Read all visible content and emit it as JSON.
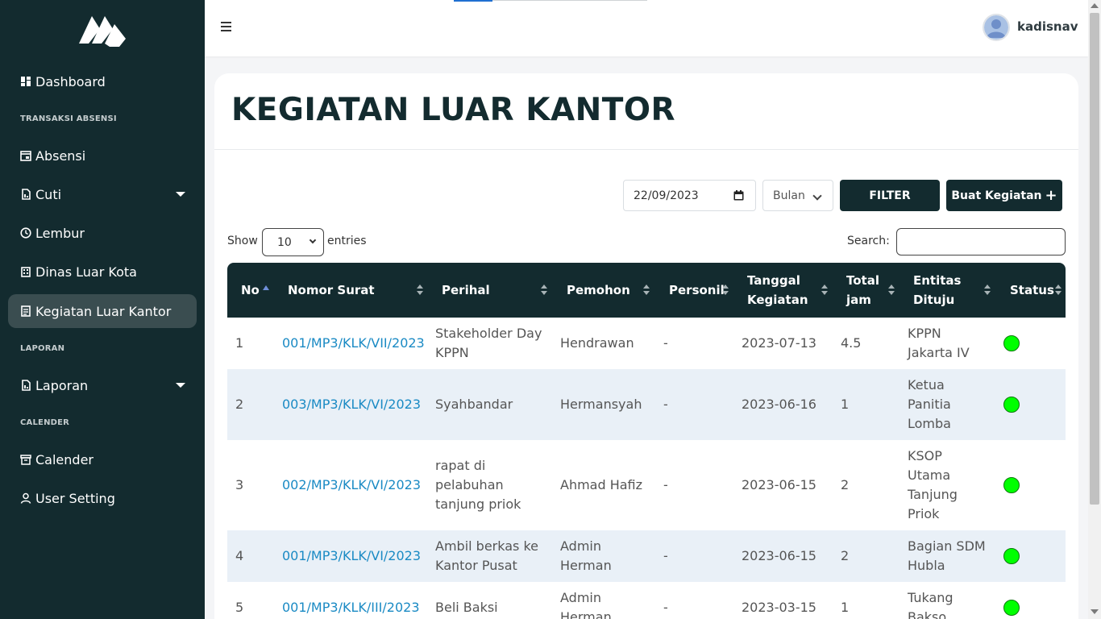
{
  "sidebar": {
    "items": [
      {
        "label": "Dashboard"
      },
      {
        "label": "Absensi"
      },
      {
        "label": "Cuti"
      },
      {
        "label": "Lembur"
      },
      {
        "label": "Dinas Luar Kota"
      },
      {
        "label": "Kegiatan Luar Kantor"
      },
      {
        "label": "Laporan"
      },
      {
        "label": "Calender"
      },
      {
        "label": "User Setting"
      }
    ],
    "sections": [
      "TRANSAKSI ABSENSI",
      "LAPORAN",
      "CALENDER"
    ]
  },
  "topbar": {
    "username": "kadisnav"
  },
  "page": {
    "title": "KEGIATAN LUAR KANTOR"
  },
  "filters": {
    "date_value": "22/09/2023",
    "month_select": "Bulan",
    "filter_label": "FILTER",
    "create_label": "Buat Kegiatan",
    "create_icon": "+"
  },
  "table_controls": {
    "show_label": "Show",
    "entries_value": "10",
    "entries_label": "entries",
    "search_label": "Search:"
  },
  "table": {
    "columns": [
      {
        "line1": "No",
        "line2": ""
      },
      {
        "line1": "Nomor Surat",
        "line2": ""
      },
      {
        "line1": "Perihal",
        "line2": ""
      },
      {
        "line1": "Pemohon",
        "line2": ""
      },
      {
        "line1": "Personil",
        "line2": ""
      },
      {
        "line1": "Tanggal",
        "line2": "Kegiatan"
      },
      {
        "line1": "Total",
        "line2": "jam"
      },
      {
        "line1": "Entitas",
        "line2": "Dituju"
      },
      {
        "line1": "Status",
        "line2": ""
      }
    ],
    "rows": [
      {
        "no": "1",
        "nomor": "001/MP3/KLK/VII/2023",
        "perihal": [
          "Stakeholder Day",
          "KPPN"
        ],
        "pemohon": [
          "Hendrawan"
        ],
        "personil": "-",
        "tanggal": "2023-07-13",
        "jam": "4.5",
        "entitas": [
          "KPPN",
          "Jakarta IV"
        ],
        "status": "active"
      },
      {
        "no": "2",
        "nomor": "003/MP3/KLK/VI/2023",
        "perihal": [
          "Syahbandar"
        ],
        "pemohon": [
          "Hermansyah"
        ],
        "personil": "-",
        "tanggal": "2023-06-16",
        "jam": "1",
        "entitas": [
          "Ketua",
          "Panitia",
          "Lomba"
        ],
        "status": "active"
      },
      {
        "no": "3",
        "nomor": "002/MP3/KLK/VI/2023",
        "perihal": [
          "rapat di",
          "pelabuhan",
          "tanjung priok"
        ],
        "pemohon": [
          "Ahmad Hafiz"
        ],
        "personil": "-",
        "tanggal": "2023-06-15",
        "jam": "2",
        "entitas": [
          "KSOP",
          "Utama",
          "Tanjung",
          "Priok"
        ],
        "status": "active"
      },
      {
        "no": "4",
        "nomor": "001/MP3/KLK/VI/2023",
        "perihal": [
          "Ambil berkas ke",
          "Kantor Pusat"
        ],
        "pemohon": [
          "Admin",
          "Herman"
        ],
        "personil": "-",
        "tanggal": "2023-06-15",
        "jam": "2",
        "entitas": [
          "Bagian SDM",
          "Hubla"
        ],
        "status": "active"
      },
      {
        "no": "5",
        "nomor": "001/MP3/KLK/III/2023",
        "perihal": [
          "Beli Baksi"
        ],
        "pemohon": [
          "Admin",
          "Herman"
        ],
        "personil": "-",
        "tanggal": "2023-03-15",
        "jam": "1",
        "entitas": [
          "Tukang",
          "Bakso"
        ],
        "status": "active"
      }
    ]
  },
  "colors": {
    "sidebar_bg": "#132b2f",
    "status_active": "#00ff00",
    "link": "#1a8ac4",
    "row_alt": "#e9f0f7"
  }
}
